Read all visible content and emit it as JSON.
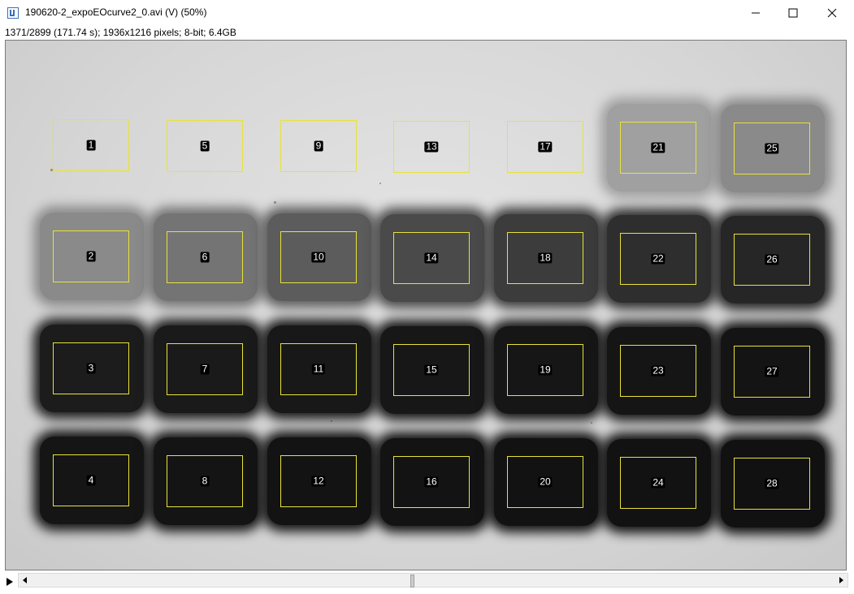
{
  "window": {
    "title": "190620-2_expoEOcurve2_0.avi (V) (50%)",
    "app_icon": "imagej-icon",
    "minimize_icon": "minimize-icon",
    "maximize_icon": "maximize-icon",
    "close_icon": "close-icon"
  },
  "info": {
    "text": "1371/2899 (171.74 s); 1936x1216 pixels; 8-bit; 6.4GB"
  },
  "image": {
    "roi_color": "#e8e23a",
    "rois": [
      {
        "label": "1"
      },
      {
        "label": "5"
      },
      {
        "label": "9"
      },
      {
        "label": "13"
      },
      {
        "label": "17"
      },
      {
        "label": "21"
      },
      {
        "label": "25"
      },
      {
        "label": "2"
      },
      {
        "label": "6"
      },
      {
        "label": "10"
      },
      {
        "label": "14"
      },
      {
        "label": "18"
      },
      {
        "label": "22"
      },
      {
        "label": "26"
      },
      {
        "label": "3"
      },
      {
        "label": "7"
      },
      {
        "label": "11"
      },
      {
        "label": "15"
      },
      {
        "label": "19"
      },
      {
        "label": "23"
      },
      {
        "label": "27"
      },
      {
        "label": "4"
      },
      {
        "label": "8"
      },
      {
        "label": "12"
      },
      {
        "label": "16"
      },
      {
        "label": "20"
      },
      {
        "label": "24"
      },
      {
        "label": "28"
      }
    ]
  },
  "controls": {
    "play_icon": "play-icon",
    "scroll_left_icon": "chevron-left-icon",
    "scroll_right_icon": "chevron-right-icon",
    "frame_position": {
      "current": 1371,
      "total": 2899
    }
  }
}
